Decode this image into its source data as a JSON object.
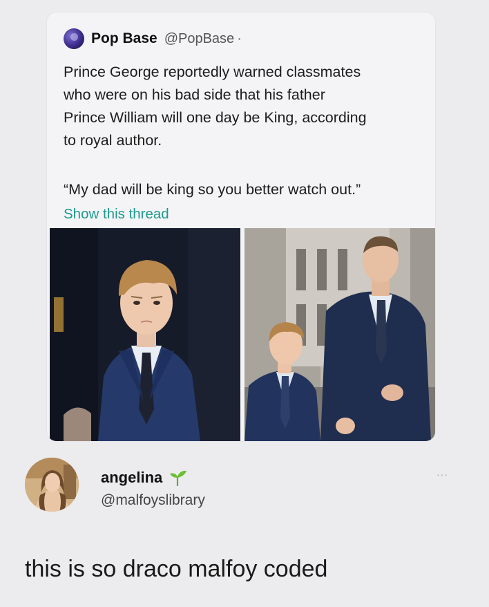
{
  "quoted_tweet": {
    "author_name": "Pop Base",
    "author_handle": "@PopBase",
    "separator": "·",
    "text": "Prince George reportedly warned classmates\nwho were on his bad side that his father\nPrince William will one day be King, according\nto royal author.",
    "quote": "“My dad will be king so you better watch out.”",
    "thread_link": "Show this thread",
    "link_color": "#1d9a8c",
    "images": [
      {
        "icon": "photo-boy-in-suit"
      },
      {
        "icon": "photo-father-and-son-walking"
      }
    ]
  },
  "reply": {
    "author_name": "angelina",
    "author_badge_icon": "seedling-icon",
    "author_handle": "@malfoyslibrary",
    "more_icon": "more-options-icon",
    "more_glyph": "···",
    "text": "this is so draco malfoy coded"
  }
}
